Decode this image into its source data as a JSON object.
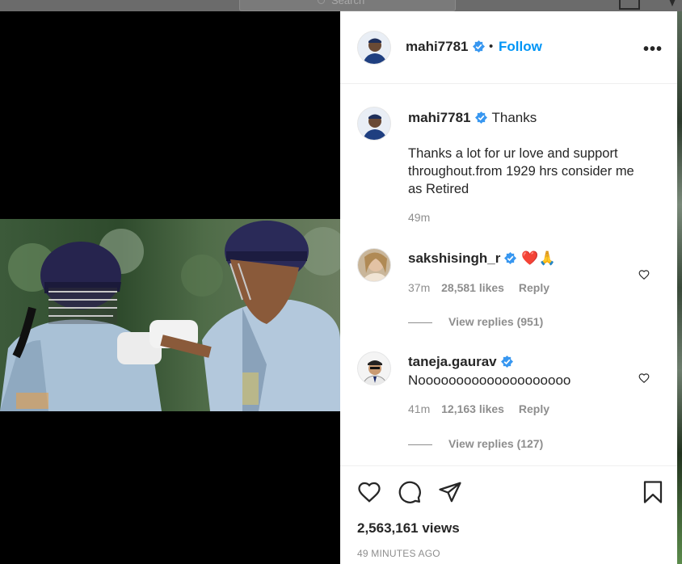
{
  "background": {
    "search_placeholder": "Search"
  },
  "post": {
    "username": "mahi7781",
    "follow_label": "Follow",
    "separator": "•",
    "more_label": "•••"
  },
  "caption": {
    "username": "mahi7781",
    "first_line": "Thanks",
    "body": "Thanks a lot for ur love and support throughout.from 1929 hrs consider me as Retired",
    "time": "49m"
  },
  "comments": [
    {
      "username": "sakshisingh_r",
      "text": "❤️🙏",
      "time": "37m",
      "likes": "28,581 likes",
      "reply_label": "Reply",
      "view_replies": "View replies (951)"
    },
    {
      "username": "taneja.gaurav",
      "text": "Noooooooooooooooooooo",
      "time": "41m",
      "likes": "12,163 likes",
      "reply_label": "Reply",
      "view_replies": "View replies (127)"
    }
  ],
  "stats": {
    "views": "2,563,161 views",
    "posted": "49 MINUTES AGO"
  },
  "colors": {
    "link_blue": "#0095f6",
    "verified_blue": "#3897f0",
    "muted": "#8e8e8e",
    "heart_red": "#ed4956"
  }
}
